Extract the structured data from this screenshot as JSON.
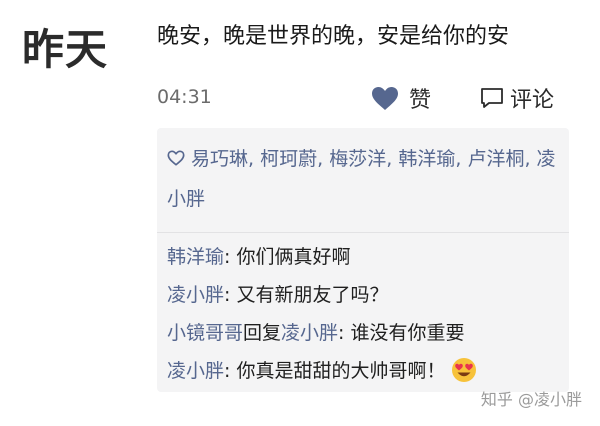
{
  "date_label": "昨天",
  "post": {
    "text": "晚安，晚是世界的晚，安是给你的安",
    "time": "04:31"
  },
  "actions": {
    "like_label": "赞",
    "like_icon": "heart-icon",
    "comment_label": "评论",
    "comment_icon": "comment-bubble-icon"
  },
  "likes": {
    "icon": "heart-outline-icon",
    "separator": ", ",
    "names": [
      "易巧琳",
      "柯珂蔚",
      "梅莎洋",
      "韩洋瑜",
      "卢洋桐",
      "凌小胖"
    ]
  },
  "comments": [
    {
      "author": "韩洋瑜",
      "separator": ": ",
      "text": "你们俩真好啊"
    },
    {
      "author": "凌小胖",
      "separator": ": ",
      "text": "又有新朋友了吗？"
    },
    {
      "author": "小镜哥哥",
      "reply_word": "回复",
      "reply_to": "凌小胖",
      "separator": ": ",
      "text": "谁没有你重要"
    },
    {
      "author": "凌小胖",
      "separator": ": ",
      "text": "你真是甜甜的大帅哥啊！",
      "emoji": "heart-eyes-emoji"
    }
  ],
  "watermark": "知乎 @凌小胖",
  "colors": {
    "name_link": "#56678f",
    "panel_bg": "#f4f4f5",
    "icon": "#56678f"
  }
}
